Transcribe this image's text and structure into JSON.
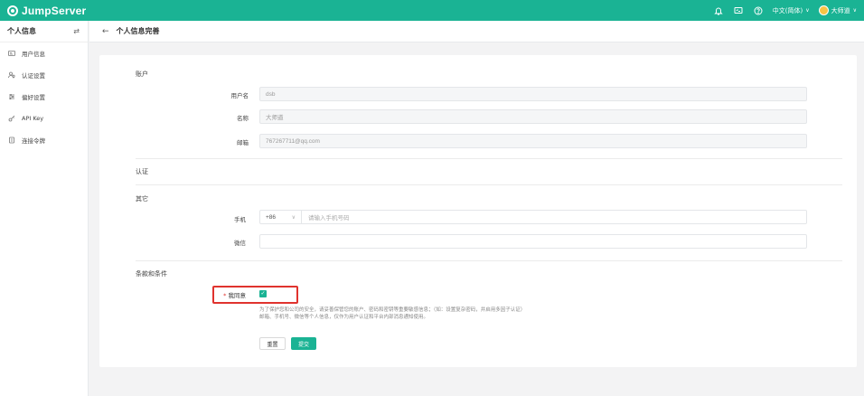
{
  "app": {
    "brand": "JumpServer",
    "accent_color": "#1ab394"
  },
  "topbar": {
    "icons": [
      "bell-icon",
      "monitor-icon",
      "help-icon"
    ],
    "language": "中文(简体)",
    "user_name": "大师道"
  },
  "sidebar": {
    "title": "个人信息",
    "items": [
      {
        "label": "用户信息",
        "icon": "id-card-icon"
      },
      {
        "label": "认证设置",
        "icon": "user-shield-icon"
      },
      {
        "label": "偏好设置",
        "icon": "sliders-icon"
      },
      {
        "label": "API Key",
        "icon": "key-icon"
      },
      {
        "label": "连接令牌",
        "icon": "token-icon"
      }
    ]
  },
  "page": {
    "title": "个人信息完善"
  },
  "form": {
    "account_section": "账户",
    "username_label": "用户名",
    "username_value": "dsb",
    "name_label": "名称",
    "name_value": "大师道",
    "email_label": "邮箱",
    "email_value": "767267711@qq.com",
    "auth_section": "认证",
    "other_section": "其它",
    "phone_label": "手机",
    "phone_prefix": "+86",
    "phone_placeholder": "请输入手机号码",
    "wechat_label": "微信",
    "wechat_value": "",
    "terms_section": "条款和条件",
    "agree_label": "我同意",
    "terms_line1": "为了保护您和公司的安全，请妥善保管您的账户、密码和密钥等重要敏感信息；（如：设置复杂密码，并启用多因子认证）",
    "terms_line2": "邮箱、手机号、微信等个人信息，仅作为用户认证和平台内部消息通知使用。",
    "reset_label": "重置",
    "submit_label": "提交",
    "agree_checked": true
  }
}
